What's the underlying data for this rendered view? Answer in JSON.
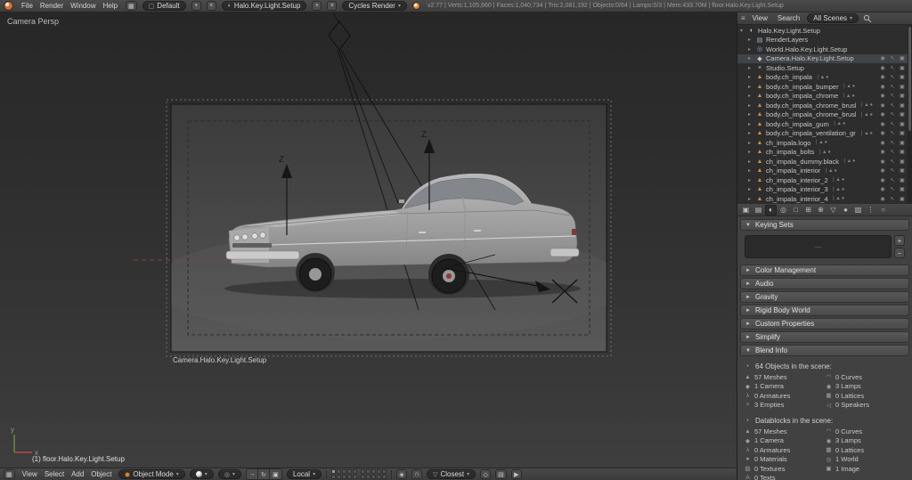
{
  "info_bar": {
    "menus": [
      "File",
      "Render",
      "Window",
      "Help"
    ],
    "layout_name": "Default",
    "scene_name": "Halo.Key.Light.Setup",
    "engine": "Cycles Render",
    "add_button": "+",
    "delete_button": "×",
    "stats": "v2.77 | Verts:1,105,660 | Faces:1,040,734 | Tris:2,081,192 | Objects:0/64 | Lamps:0/3 | Mem:433.70M | floor.Halo.Key.Light.Setup"
  },
  "viewport": {
    "view_label": "Camera Persp",
    "camera_name": "Camera.Halo.Key.Light.Setup",
    "active_object": "(1) floor.Halo.Key.Light.Setup",
    "empty_label_1": "Z",
    "empty_label_2": "Z",
    "axis_x_label": "x",
    "axis_y_label": "y"
  },
  "outliner": {
    "menus": [
      "View",
      "Search"
    ],
    "filter": "All Scenes",
    "items": [
      {
        "label": "Halo.Key.Light.Setup",
        "icon": "scene",
        "indent": 0,
        "restrict": false,
        "selected": false,
        "expander": "collapse"
      },
      {
        "label": "RenderLayers",
        "icon": "renderlayers",
        "indent": 1,
        "restrict": false,
        "selected": false,
        "expander": "expand"
      },
      {
        "label": "World.Halo.Key.Light.Setup",
        "icon": "world",
        "indent": 1,
        "restrict": false,
        "selected": false,
        "expander": "expand"
      },
      {
        "label": "Camera.Halo.Key.Light.Setup",
        "icon": "camera",
        "indent": 1,
        "restrict": true,
        "selected": true,
        "expander": "expand"
      },
      {
        "label": "Studio.Setup",
        "icon": "empty",
        "indent": 1,
        "restrict": true,
        "selected": false,
        "expander": "expand"
      },
      {
        "label": "body.ch_impala",
        "icon": "mesh",
        "indent": 1,
        "restrict": true,
        "selected": false,
        "expander": "expand"
      },
      {
        "label": "body.ch_impala_bumper",
        "icon": "mesh",
        "indent": 1,
        "restrict": true,
        "selected": false,
        "expander": "expand"
      },
      {
        "label": "body.ch_impala_chrome",
        "icon": "mesh",
        "indent": 1,
        "restrict": true,
        "selected": false,
        "expander": "expand"
      },
      {
        "label": "body.ch_impala_chrome_brushed",
        "icon": "mesh",
        "indent": 1,
        "restrict": true,
        "selected": false,
        "expander": "expand"
      },
      {
        "label": "body.ch_impala_chrome_brushed_misc",
        "icon": "mesh",
        "indent": 1,
        "restrict": true,
        "selected": false,
        "expander": "expand"
      },
      {
        "label": "body.ch_impala_gum",
        "icon": "mesh",
        "indent": 1,
        "restrict": true,
        "selected": false,
        "expander": "expand"
      },
      {
        "label": "body.ch_impala_ventilation_grills",
        "icon": "mesh",
        "indent": 1,
        "restrict": true,
        "selected": false,
        "expander": "expand"
      },
      {
        "label": "ch_impala.logo",
        "icon": "mesh",
        "indent": 1,
        "restrict": true,
        "selected": false,
        "expander": "expand"
      },
      {
        "label": "ch_impala_bolts",
        "icon": "mesh",
        "indent": 1,
        "restrict": true,
        "selected": false,
        "expander": "expand"
      },
      {
        "label": "ch_impala_dummy.black",
        "icon": "mesh",
        "indent": 1,
        "restrict": true,
        "selected": false,
        "expander": "expand"
      },
      {
        "label": "ch_impala_interior",
        "icon": "mesh",
        "indent": 1,
        "restrict": true,
        "selected": false,
        "expander": "expand"
      },
      {
        "label": "ch_impala_interior_2",
        "icon": "mesh",
        "indent": 1,
        "restrict": true,
        "selected": false,
        "expander": "expand"
      },
      {
        "label": "ch_impala_interior_3",
        "icon": "mesh",
        "indent": 1,
        "restrict": true,
        "selected": false,
        "expander": "expand"
      },
      {
        "label": "ch_impala_interior_4",
        "icon": "mesh",
        "indent": 1,
        "restrict": true,
        "selected": false,
        "expander": "expand"
      }
    ]
  },
  "properties": {
    "tabs": [
      "render",
      "render-layers",
      "scene",
      "world",
      "object",
      "constraints",
      "modifiers",
      "object-data",
      "material",
      "texture",
      "particles",
      "physics"
    ],
    "active_tab": "scene",
    "panels": [
      {
        "label": "Keying Sets",
        "expanded": true,
        "content": "keying"
      },
      {
        "label": "Color Management",
        "expanded": false
      },
      {
        "label": "Audio",
        "expanded": false
      },
      {
        "label": "Gravity",
        "expanded": false
      },
      {
        "label": "Rigid Body World",
        "expanded": false
      },
      {
        "label": "Custom Properties",
        "expanded": false
      },
      {
        "label": "Simplify",
        "expanded": false
      },
      {
        "label": "Blend Info",
        "expanded": true,
        "content": "blend"
      }
    ],
    "keying_sets": {
      "empty_placeholder": "—",
      "add_label": "+",
      "remove_label": "−"
    },
    "blend_info": {
      "objects_title": "64 Objects in the scene:",
      "objects_rows": [
        [
          {
            "icon": "mesh",
            "label": "57 Meshes"
          },
          {
            "icon": "curve",
            "label": "0 Curves"
          }
        ],
        [
          {
            "icon": "camera",
            "label": "1 Camera"
          },
          {
            "icon": "lamp",
            "label": "3 Lamps"
          }
        ],
        [
          {
            "icon": "armature",
            "label": "0 Armatures"
          },
          {
            "icon": "lattice",
            "label": "0 Lattices"
          }
        ],
        [
          {
            "icon": "empty",
            "label": "3 Empties"
          },
          {
            "icon": "speaker",
            "label": "0 Speakers"
          }
        ]
      ],
      "datablocks_title": "Datablocks in the scene:",
      "datablocks_rows": [
        [
          {
            "icon": "mesh",
            "label": "57 Meshes"
          },
          {
            "icon": "curve",
            "label": "0 Curves"
          }
        ],
        [
          {
            "icon": "camera",
            "label": "1 Camera"
          },
          {
            "icon": "lamp",
            "label": "3 Lamps"
          }
        ],
        [
          {
            "icon": "armature",
            "label": "0 Armatures"
          },
          {
            "icon": "lattice",
            "label": "0 Lattices"
          }
        ],
        [
          {
            "icon": "material",
            "label": "0 Materials"
          },
          {
            "icon": "world",
            "label": "1 World"
          }
        ],
        [
          {
            "icon": "texture",
            "label": "0 Textures"
          },
          {
            "icon": "image",
            "label": "1 Image"
          }
        ],
        [
          {
            "icon": "text",
            "label": "0 Texts"
          },
          null
        ]
      ]
    }
  },
  "view3d_header": {
    "menus": [
      "View",
      "Select",
      "Add",
      "Object"
    ],
    "mode": "Object Mode",
    "orientation": "Local",
    "snap_element": "Closest",
    "active_layer": 0
  }
}
